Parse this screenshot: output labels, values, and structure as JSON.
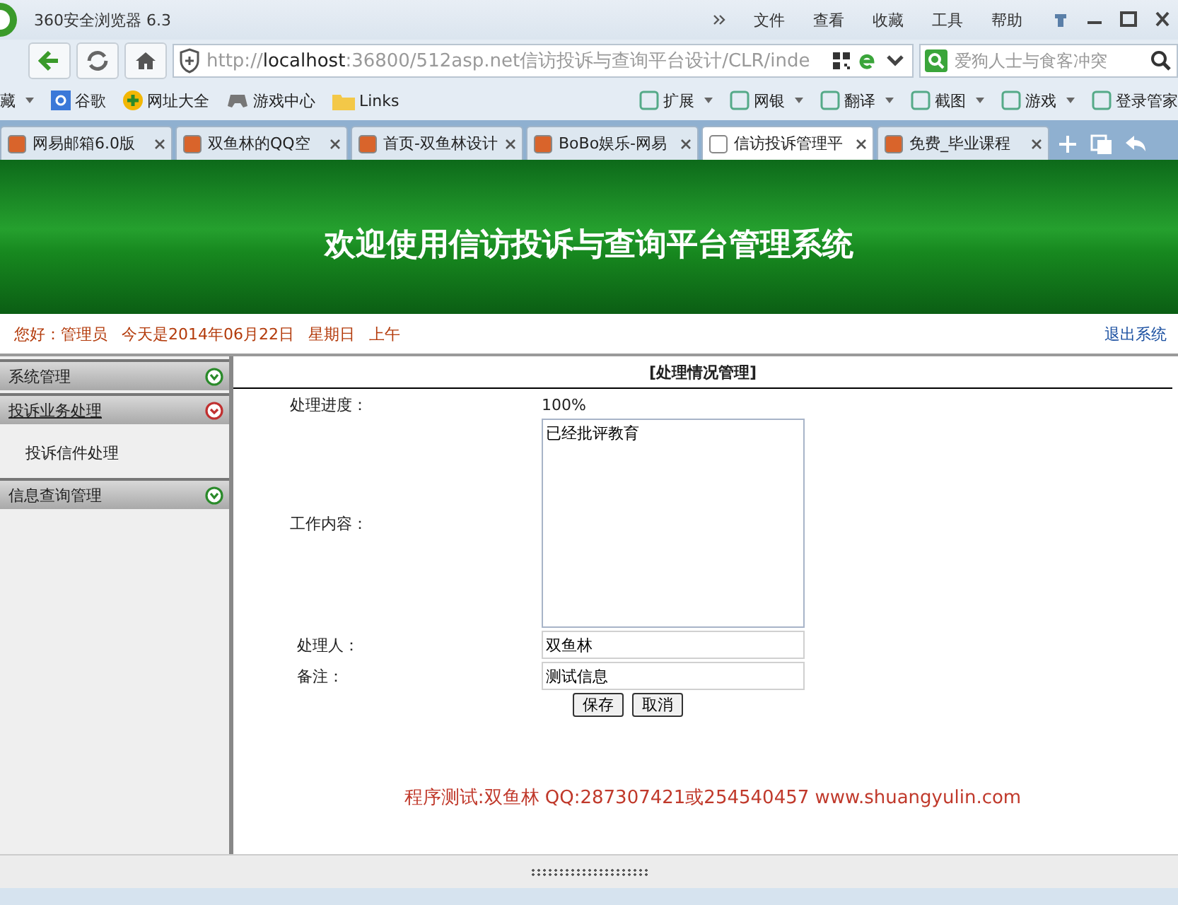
{
  "browser": {
    "title": "360安全浏览器 6.3",
    "menu": [
      "文件",
      "查看",
      "收藏",
      "工具",
      "帮助"
    ],
    "url": {
      "scheme": "http://",
      "host": "localhost",
      "path": ":36800/512asp.net信访投诉与查询平台设计/CLR/inde"
    },
    "search": {
      "placeholder": "爱狗人士与食客冲突"
    },
    "bookmarks_left": [
      {
        "label": "藏",
        "kind": "menu"
      },
      {
        "label": "谷歌",
        "kind": "google"
      },
      {
        "label": "网址大全",
        "kind": "plus"
      },
      {
        "label": "游戏中心",
        "kind": "game"
      },
      {
        "label": "Links",
        "kind": "folder"
      }
    ],
    "bookmarks_right": [
      "扩展",
      "网银",
      "翻译",
      "截图",
      "游戏",
      "登录管家"
    ],
    "tabs": [
      {
        "label": "网易邮箱6.0版",
        "selected": false
      },
      {
        "label": "双鱼林的QQ空",
        "selected": false
      },
      {
        "label": "首页-双鱼林设计",
        "selected": false
      },
      {
        "label": "BoBo娱乐-网易",
        "selected": false
      },
      {
        "label": "信访投诉管理平",
        "selected": true
      },
      {
        "label": "免费_毕业课程",
        "selected": false
      }
    ]
  },
  "page": {
    "banner_title": "欢迎使用信访投诉与查询平台管理系统",
    "greeting": {
      "user": "您好：管理员",
      "date": "今天是2014年06月22日",
      "weekday": "星期日",
      "period": "上午"
    },
    "logout": "退出系统",
    "sidebar": [
      {
        "label": "系统管理",
        "expanded": false
      },
      {
        "label": "投诉业务处理",
        "expanded": true,
        "children": [
          {
            "label": "投诉信件处理"
          }
        ]
      },
      {
        "label": "信息查询管理",
        "expanded": false
      }
    ],
    "form": {
      "title": "[处理情况管理]",
      "fields": [
        {
          "kind": "plain",
          "label": "处理进度：",
          "value": "100%"
        },
        {
          "kind": "textarea",
          "label": "工作内容：",
          "value": "已经批评教育"
        },
        {
          "kind": "input",
          "label": "处理人：",
          "value": "双鱼林"
        },
        {
          "kind": "input",
          "label": "备注：",
          "value": "测试信息"
        }
      ],
      "buttons": [
        "保存",
        "取消"
      ]
    },
    "footer_note": "程序测试:双鱼林 QQ:287307421或254540457 www.shuangyulin.com"
  }
}
